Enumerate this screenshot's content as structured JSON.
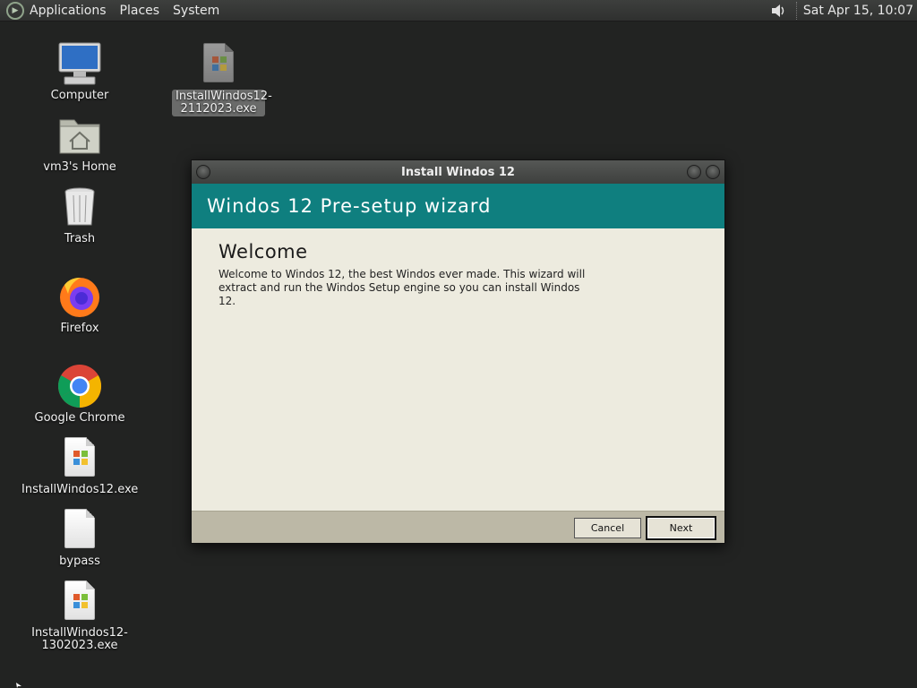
{
  "panel": {
    "menus": [
      "Applications",
      "Places",
      "System"
    ],
    "clock": "Sat Apr 15, 10:07"
  },
  "desktop": {
    "icons": [
      {
        "label": "Computer",
        "icon": "computer-icon"
      },
      {
        "label": "vm3's Home",
        "icon": "home-folder-icon"
      },
      {
        "label": "Trash",
        "icon": "trash-icon"
      },
      {
        "label": "Firefox",
        "icon": "firefox-icon"
      },
      {
        "label": "Google Chrome",
        "icon": "chrome-icon"
      },
      {
        "label": "InstallWindos12.exe",
        "icon": "exe-file-icon"
      },
      {
        "label": "bypass",
        "icon": "blank-file-icon"
      },
      {
        "label": "InstallWindos12-1302023.exe",
        "icon": "exe-file-icon"
      }
    ],
    "selected_icon": {
      "label": "InstallWindos12-2112023.exe",
      "icon": "exe-file-icon"
    }
  },
  "window": {
    "title": "Install Windos 12",
    "header": "Windos 12 Pre-setup wizard",
    "page_title": "Welcome",
    "text": "Welcome to Windos 12, the best Windos ever made. This wizard will extract and run the Windos Setup engine so you can install Windos 12.",
    "cancel_label": "Cancel",
    "next_label": "Next"
  },
  "colors": {
    "wizard_header": "#0f7f7f",
    "desktop_bg": "#222322"
  }
}
